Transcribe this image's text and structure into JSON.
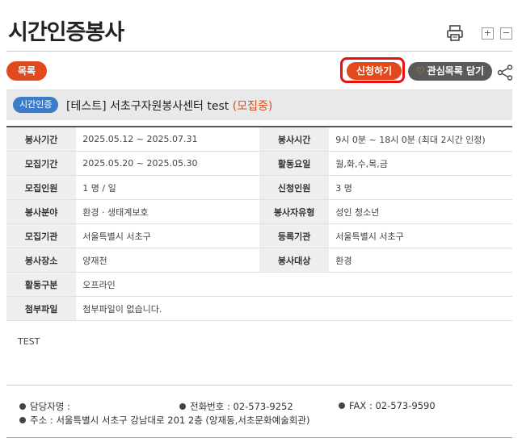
{
  "page": {
    "title": "시간인증봉사",
    "zoom_in": "+",
    "zoom_out": "−"
  },
  "actions": {
    "list": "목록",
    "apply": "신청하기",
    "favorite": "관심목록 담기"
  },
  "post": {
    "category": "시간인증",
    "title": "[테스트] 서초구자원봉사센터 test",
    "status": "(모집중)"
  },
  "details": [
    {
      "label1": "봉사기간",
      "value1": "2025.05.12 ~ 2025.07.31",
      "label2": "봉사시간",
      "value2": "9시 0분 ~ 18시 0분 (최대 2시간 인정)"
    },
    {
      "label1": "모집기간",
      "value1": "2025.05.20 ~ 2025.05.30",
      "label2": "활동요일",
      "value2": "월,화,수,목,금"
    },
    {
      "label1": "모집인원",
      "value1": "1 명 / 일",
      "label2": "신청인원",
      "value2": "3 명"
    },
    {
      "label1": "봉사분야",
      "value1": "환경 · 생태계보호",
      "label2": "봉사자유형",
      "value2": "성인  청소년"
    },
    {
      "label1": "모집기관",
      "value1": "서울특별시 서초구",
      "label2": "등록기관",
      "value2": "서울특별시 서초구"
    },
    {
      "label1": "봉사장소",
      "value1": "양재천",
      "label2": "봉사대상",
      "value2": "환경"
    },
    {
      "label1": "활동구분",
      "value1": "오프라인"
    },
    {
      "label1": "첨부파일",
      "value1": "첨부파일이 없습니다."
    }
  ],
  "description": "TEST",
  "footer": {
    "manager": "담당자명 :",
    "phone": "전화번호 : 02-573-9252",
    "fax": "FAX : 02-573-9590",
    "address": "주소 : 서울특별시 서초구 강남대로 201 2층 (양재동,서초문화예술회관)"
  }
}
